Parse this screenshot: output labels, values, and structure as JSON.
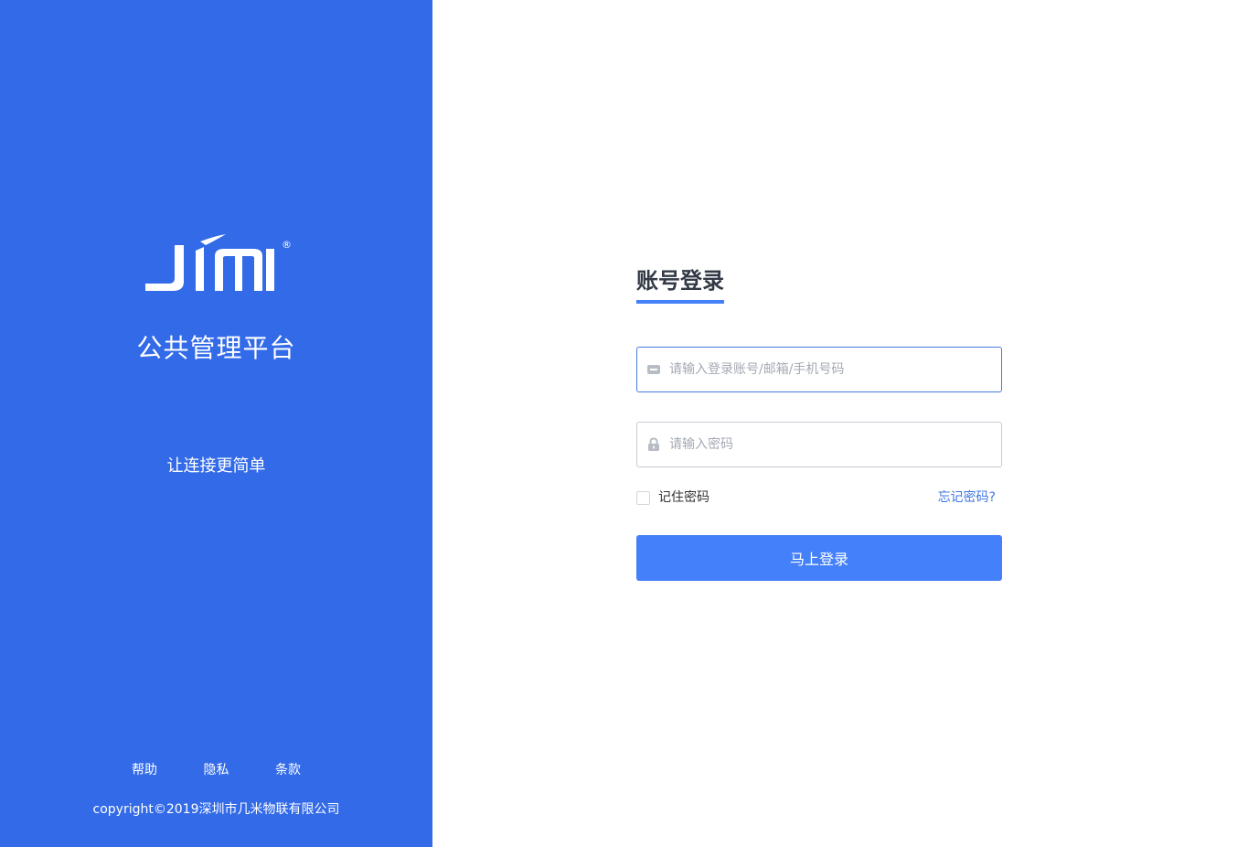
{
  "colors": {
    "left_panel": "#326ae8",
    "accent": "#4380f9",
    "link": "#3f76e6",
    "text_dark": "#333a46",
    "placeholder": "#a4a9b3"
  },
  "brand": {
    "logo_text": "JIMI",
    "logo_icon": "jimi-logo",
    "registered_mark": "®",
    "platform_name": "公共管理平台",
    "slogan": "让连接更简单"
  },
  "footer": {
    "links": [
      "帮助",
      "隐私",
      "条款"
    ],
    "copyright": "copyright©2019深圳市几米物联有限公司"
  },
  "login": {
    "title": "账号登录",
    "account": {
      "placeholder": "请输入登录账号/邮箱/手机号码",
      "value": "",
      "icon": "id-card-icon"
    },
    "password": {
      "placeholder": "请输入密码",
      "value": "",
      "icon": "lock-icon"
    },
    "remember_label": "记住密码",
    "remember_checked": false,
    "forgot_label": "忘记密码?",
    "submit_label": "马上登录"
  }
}
